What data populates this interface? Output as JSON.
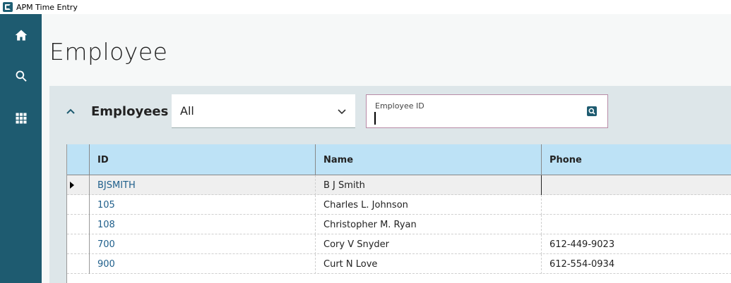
{
  "app": {
    "title": "APM Time Entry"
  },
  "sidebar": {
    "items": [
      {
        "name": "home",
        "icon": "home-icon"
      },
      {
        "name": "search",
        "icon": "search-icon"
      },
      {
        "name": "apps",
        "icon": "grid-icon"
      }
    ]
  },
  "page": {
    "title": "Employee"
  },
  "panel": {
    "label": "Employees",
    "filter": {
      "selected": "All"
    },
    "employee_id": {
      "label": "Employee ID",
      "value": "",
      "placeholder": ""
    }
  },
  "table": {
    "columns": [
      "ID",
      "Name",
      "Phone"
    ],
    "rows": [
      {
        "id": "BJSMITH",
        "name": "B J Smith",
        "phone": ""
      },
      {
        "id": "105",
        "name": "Charles L. Johnson",
        "phone": ""
      },
      {
        "id": "108",
        "name": "Christopher M. Ryan",
        "phone": ""
      },
      {
        "id": "700",
        "name": "Cory V Snyder",
        "phone": "612-449-9023"
      },
      {
        "id": "900",
        "name": "Curt N Love",
        "phone": "612-554-0934"
      }
    ]
  },
  "colors": {
    "sidebar": "#1e5b70",
    "header": "#bde2f6",
    "link": "#1f5f8b",
    "field_border": "#b78aa6"
  }
}
